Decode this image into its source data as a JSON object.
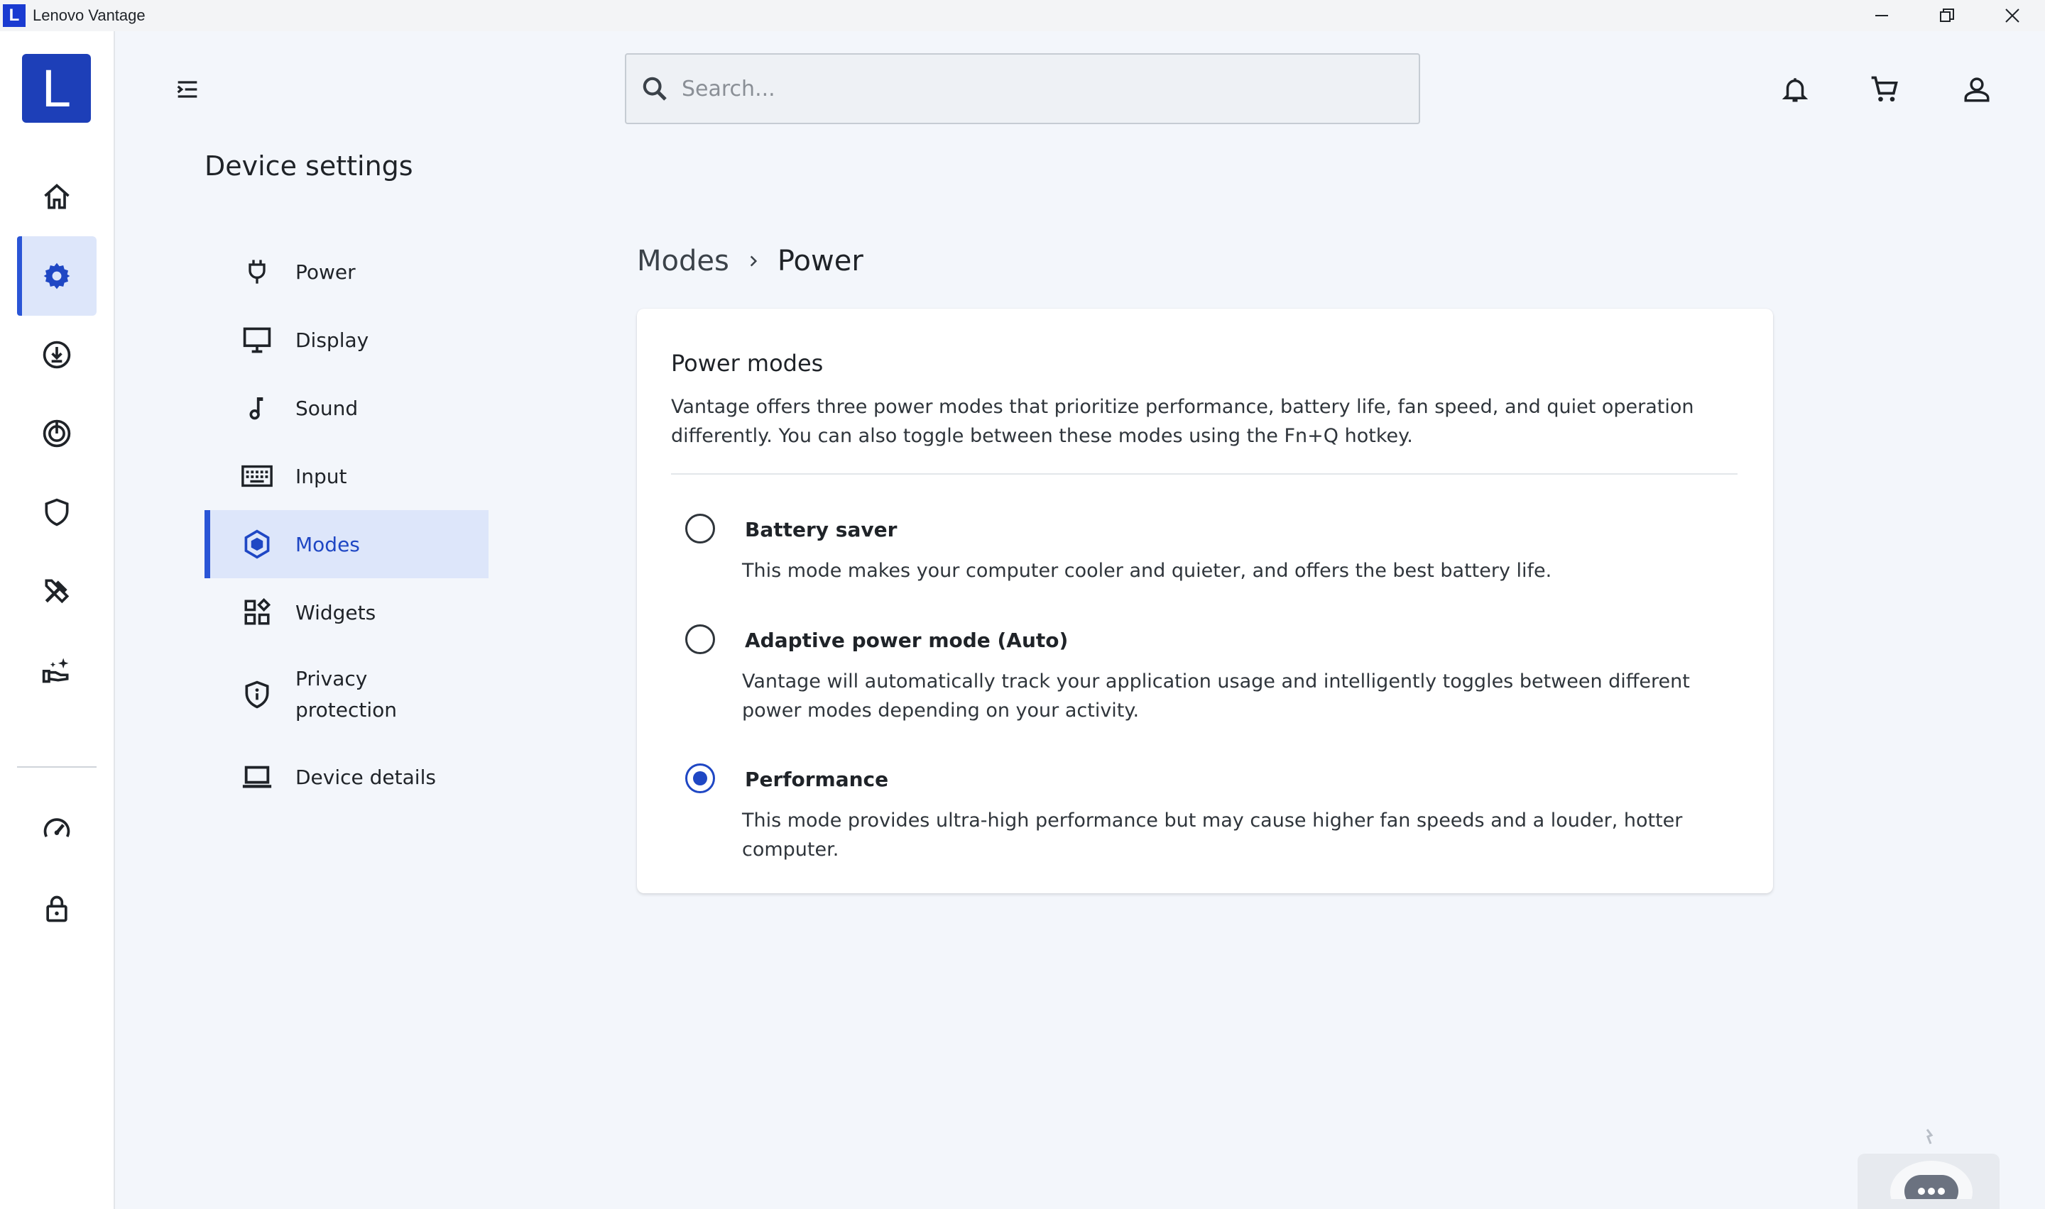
{
  "window": {
    "title": "Lenovo Vantage",
    "logo_letter": "L"
  },
  "rail": {
    "brand_letter": "L",
    "items": [
      {
        "icon": "home-icon",
        "active": false
      },
      {
        "icon": "gear-icon",
        "active": true
      },
      {
        "icon": "download-icon",
        "active": false
      },
      {
        "icon": "gaming-icon",
        "active": false
      },
      {
        "icon": "shield-icon",
        "active": false
      },
      {
        "icon": "tools-icon",
        "active": false
      },
      {
        "icon": "support-hand-icon",
        "active": false
      },
      {
        "icon": "speedometer-icon",
        "active": false
      },
      {
        "icon": "lock-icon",
        "active": false
      }
    ]
  },
  "search": {
    "placeholder": "Search..."
  },
  "page": {
    "title": "Device settings"
  },
  "subnav": {
    "items": [
      {
        "label": "Power",
        "icon": "plug-icon"
      },
      {
        "label": "Display",
        "icon": "monitor-icon"
      },
      {
        "label": "Sound",
        "icon": "music-note-icon"
      },
      {
        "label": "Input",
        "icon": "keyboard-icon"
      },
      {
        "label": "Modes",
        "icon": "hexagon-icon",
        "active": true
      },
      {
        "label": "Widgets",
        "icon": "widgets-icon"
      },
      {
        "label_line1": "Privacy",
        "label_line2": "protection",
        "icon": "privacy-shield-icon"
      },
      {
        "label": "Device details",
        "icon": "laptop-icon"
      }
    ]
  },
  "breadcrumb": {
    "parent": "Modes",
    "current": "Power"
  },
  "power_modes": {
    "title": "Power modes",
    "description": "Vantage offers three power modes that prioritize performance, battery life, fan speed, and quiet operation differently. You can also toggle between these modes using the Fn+Q hotkey.",
    "options": [
      {
        "title": "Battery saver",
        "description": "This mode makes your computer cooler and quieter, and offers the best battery life.",
        "selected": false
      },
      {
        "title": "Adaptive power mode (Auto)",
        "description": "Vantage will automatically track your application usage and intelligently toggles between different power modes depending on your activity.",
        "selected": false
      },
      {
        "title": "Performance",
        "description": "This mode provides ultra-high performance but may cause higher fan speeds and a louder, hotter computer.",
        "selected": true
      }
    ]
  },
  "colors": {
    "accent": "#1f47c4",
    "brand": "#1d3fb8",
    "active_bg": "#dde6fa"
  }
}
